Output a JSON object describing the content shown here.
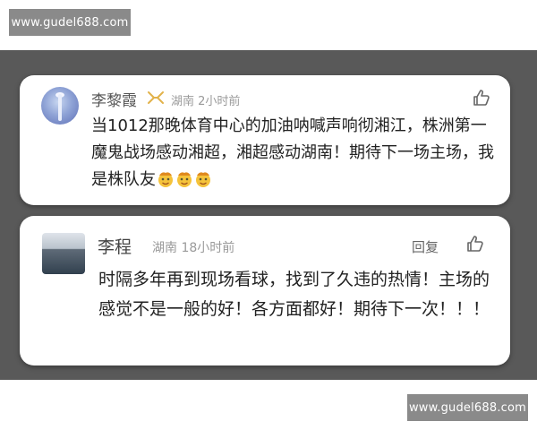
{
  "watermark": {
    "top": "www.gudel688.com",
    "bottom": "www.gudel688.com"
  },
  "comments": [
    {
      "author": "李黎霞",
      "badge_icon": "fan-badge-icon",
      "location": "湖南",
      "time": "2小时前",
      "text": "当1012那晚体育中心的加油呐喊声响彻湘江，株洲第一魔鬼战场感动湘超，湘超感动湖南！期待下一场主场，我是株队友",
      "emojis": [
        "lion-face-emoji",
        "lion-face-emoji",
        "lion-face-emoji"
      ],
      "like_icon": "thumbs-up-icon"
    },
    {
      "author": "李程",
      "location": "湖南",
      "time": "18小时前",
      "reply_label": "回复",
      "text": "时隔多年再到现场看球，找到了久违的热情！主场的感觉不是一般的好！各方面都好！期待下一次！！！",
      "like_icon": "thumbs-up-icon"
    }
  ],
  "colors": {
    "backdrop": "#595959",
    "card": "#ffffff",
    "watermark_bg": "#8a8a8a",
    "meta_text": "#9a9a9a"
  }
}
